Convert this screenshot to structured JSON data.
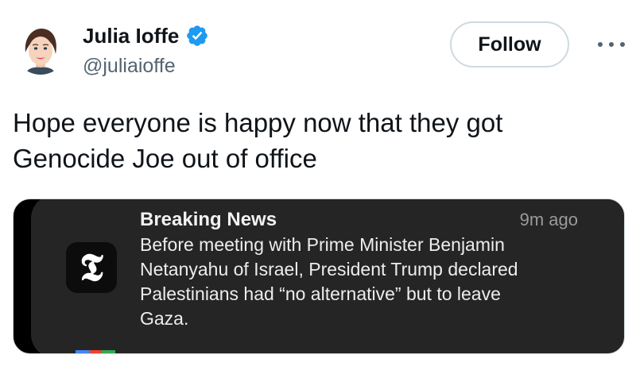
{
  "author": {
    "display_name": "Julia Ioffe",
    "handle": "@juliaioffe",
    "verified": true
  },
  "follow_label": "Follow",
  "icons": {
    "more": "more-horizontal-icon",
    "verified": "verified-badge-icon",
    "nyt": "nyt-logo-icon"
  },
  "tweet": {
    "text": "Hope everyone is happy now that they got\nGenocide Joe out of office"
  },
  "embedded_notification": {
    "app_icon_glyph": "𝕿",
    "title": "Breaking News",
    "time": "9m ago",
    "body": "Before meeting with Prime Minister Benjamin\nNetanyahu of Israel, President Trump declared\nPalestinians had “no alternative” but to leave\nGaza."
  },
  "colors": {
    "accent_verified": "#1d9bf0",
    "follow_border": "#cfd9de",
    "secondary_text": "#536471",
    "notification_bg": "#252525"
  }
}
